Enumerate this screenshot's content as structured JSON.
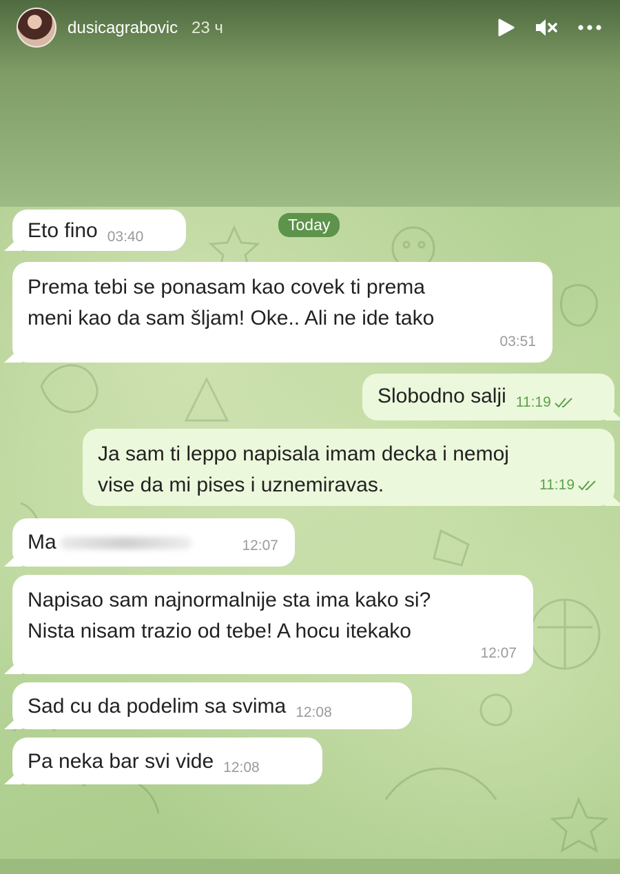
{
  "story": {
    "username": "dusicagrabovic",
    "time_ago": "23 ч",
    "icons": [
      "avatar",
      "play-icon",
      "mute-icon",
      "more-icon"
    ]
  },
  "chat": {
    "date_label": "Today",
    "messages": [
      {
        "direction": "in",
        "text": "Eto fino",
        "time": "03:40"
      },
      {
        "direction": "in",
        "lines": [
          "Prema tebi se ponasam kao covek ti prema",
          "meni kao da sam šljam!  Oke..  Ali ne ide tako"
        ],
        "time": "03:51"
      },
      {
        "direction": "out",
        "text": "Slobodno salji",
        "time": "11:19"
      },
      {
        "direction": "out",
        "lines": [
          "Ja sam ti leppo napisala imam decka i nemoj",
          "vise da mi pises i uznemiravas."
        ],
        "time": "11:19"
      },
      {
        "direction": "in",
        "text": "Ma",
        "time": "12:07"
      },
      {
        "direction": "in",
        "lines": [
          "Napisao sam najnormalnije sta ima kako si?",
          "Nista nisam trazio od tebe!  A hocu itekako"
        ],
        "time": "12:07"
      },
      {
        "direction": "in",
        "text": "Sad cu da podelim sa svima",
        "time": "12:08"
      },
      {
        "direction": "in",
        "text": "Pa neka bar svi vide",
        "time": "12:08"
      }
    ]
  },
  "colors": {
    "incoming_bubble": "#ffffff",
    "outgoing_bubble": "#ecf8dc",
    "read_ticks": "#5ca04b",
    "date_pill": "#4b873c"
  }
}
